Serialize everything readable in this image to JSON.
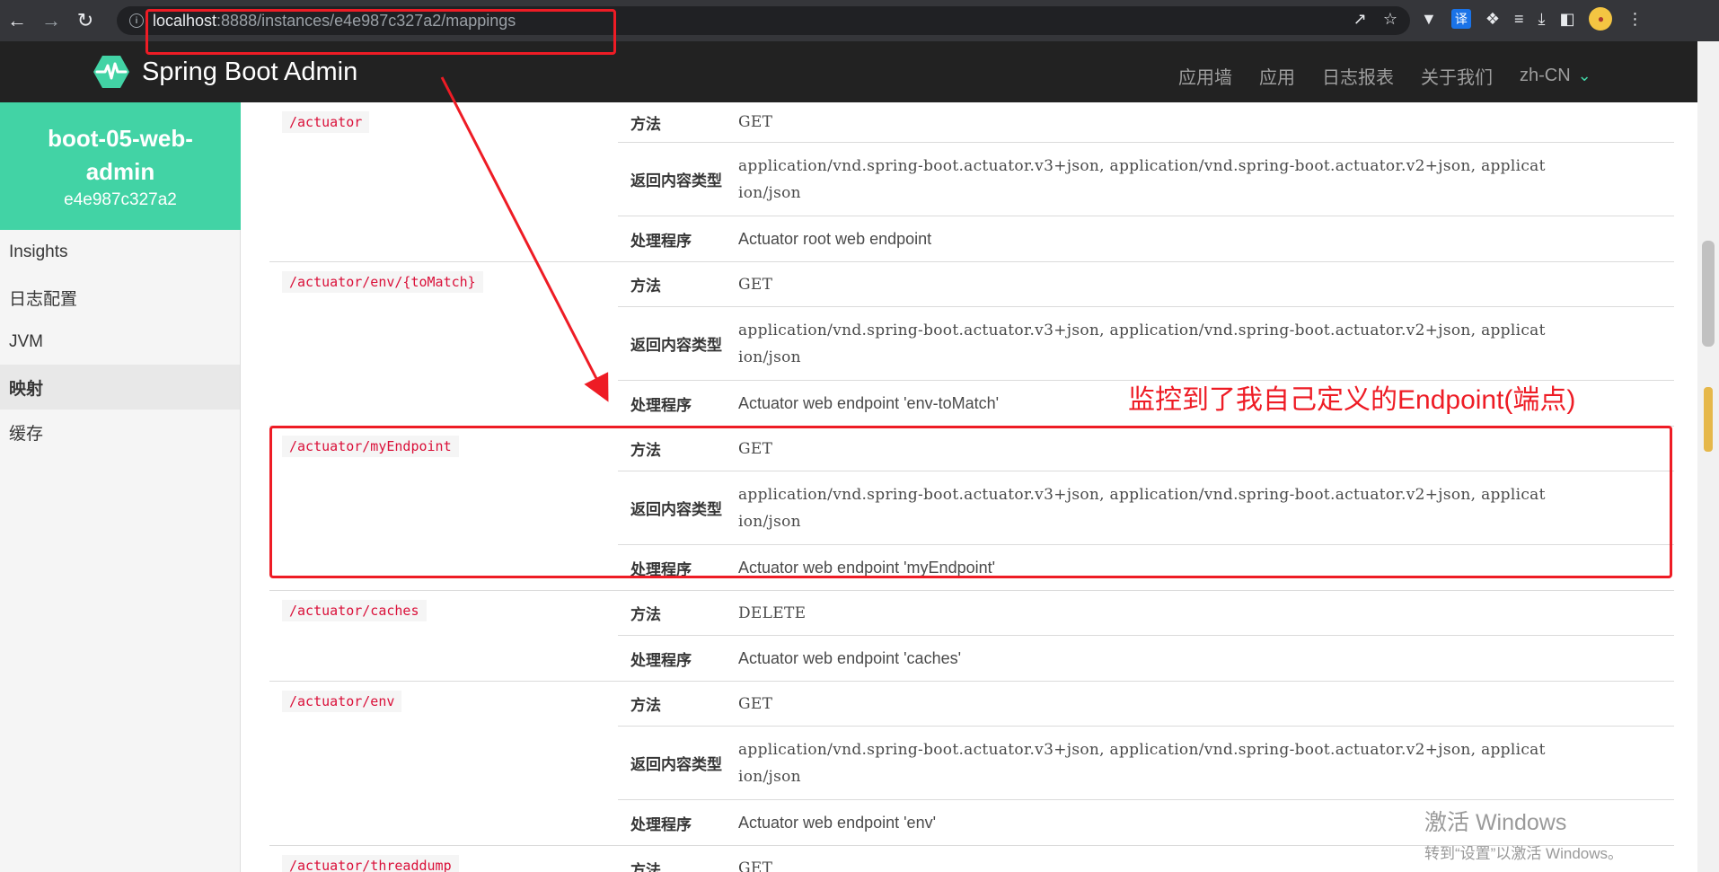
{
  "browser": {
    "url_host": "localhost",
    "url_path": ":8888/instances/e4e987c327a2/mappings",
    "translate_label": "译"
  },
  "navbar": {
    "brand": "Spring Boot Admin",
    "menu": [
      "应用墙",
      "应用",
      "日志报表",
      "关于我们"
    ],
    "language": "zh-CN"
  },
  "sidebar": {
    "app_name_line1": "boot-05-web-",
    "app_name_line2": "admin",
    "app_id": "e4e987c327a2",
    "items": [
      {
        "label": "Insights",
        "active": false
      },
      {
        "label": "日志配置",
        "active": false
      },
      {
        "label": "JVM",
        "active": false
      },
      {
        "label": "映射",
        "active": true
      },
      {
        "label": "缓存",
        "active": false
      }
    ]
  },
  "labels": {
    "method": "方法",
    "produces": "返回内容类型",
    "handler": "处理程序"
  },
  "mappings": [
    {
      "route": "/actuator",
      "method": "GET",
      "produces_line1": "application/vnd.spring-boot.actuator.v3+json, application/vnd.spring-boot.actuator.v2+json, applicat",
      "produces_line2": "ion/json",
      "handler": "Actuator root web endpoint"
    },
    {
      "route": "/actuator/env/{toMatch}",
      "method": "GET",
      "produces_line1": "application/vnd.spring-boot.actuator.v3+json, application/vnd.spring-boot.actuator.v2+json, applicat",
      "produces_line2": "ion/json",
      "handler": "Actuator web endpoint 'env-toMatch'"
    },
    {
      "route": "/actuator/myEndpoint",
      "method": "GET",
      "produces_line1": "application/vnd.spring-boot.actuator.v3+json, application/vnd.spring-boot.actuator.v2+json, applicat",
      "produces_line2": "ion/json",
      "handler": "Actuator web endpoint 'myEndpoint'"
    },
    {
      "route": "/actuator/caches",
      "method": "DELETE",
      "handler": "Actuator web endpoint 'caches'"
    },
    {
      "route": "/actuator/env",
      "method": "GET",
      "produces_line1": "application/vnd.spring-boot.actuator.v3+json, application/vnd.spring-boot.actuator.v2+json, applicat",
      "produces_line2": "ion/json",
      "handler": "Actuator web endpoint 'env'"
    },
    {
      "route": "/actuator/threaddump",
      "method": "GET"
    }
  ],
  "annotation": {
    "text": "监控到了我自己定义的Endpoint(端点)",
    "color": "#ee1c25"
  },
  "watermark": {
    "line1": "激活 Windows",
    "line2": "转到“设置”以激活 Windows。"
  },
  "colors": {
    "accent": "#42d3a5",
    "navbar": "#222222",
    "route_text": "#da1039"
  }
}
